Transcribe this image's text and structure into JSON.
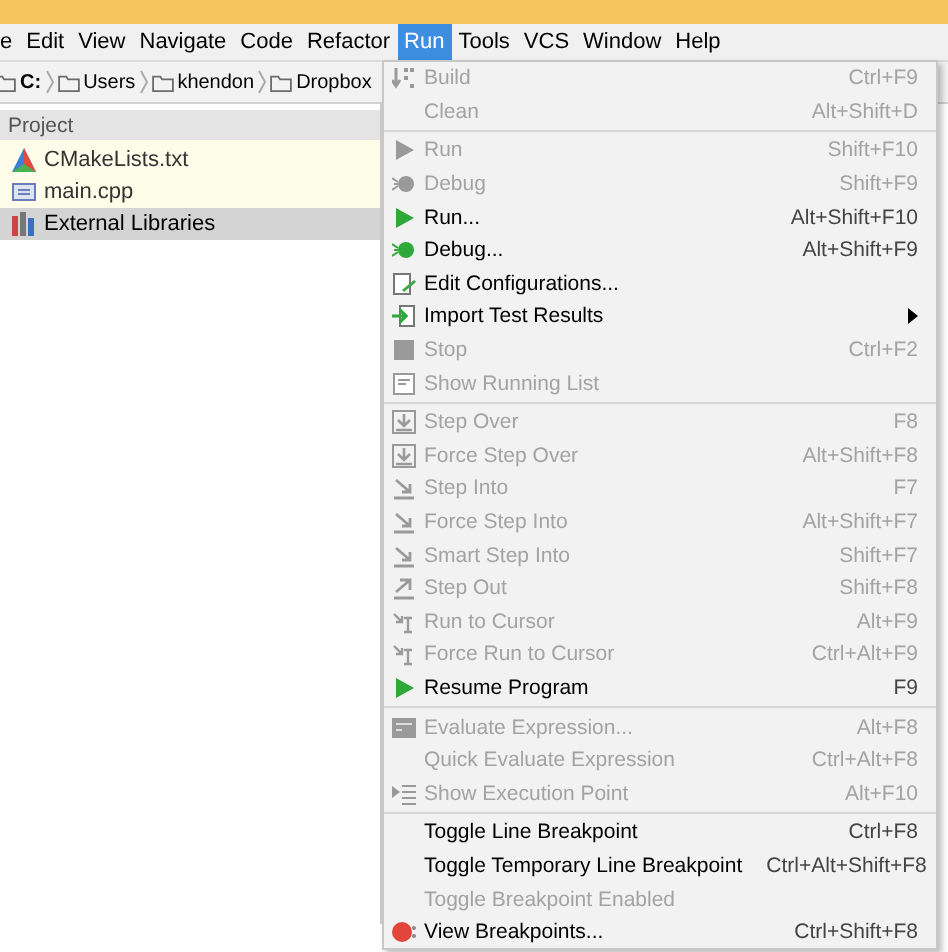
{
  "menubar": [
    {
      "label": "e",
      "selected": false
    },
    {
      "label": "Edit",
      "selected": false
    },
    {
      "label": "View",
      "selected": false
    },
    {
      "label": "Navigate",
      "selected": false
    },
    {
      "label": "Code",
      "selected": false
    },
    {
      "label": "Refactor",
      "selected": false
    },
    {
      "label": "Run",
      "selected": true
    },
    {
      "label": "Tools",
      "selected": false
    },
    {
      "label": "VCS",
      "selected": false
    },
    {
      "label": "Window",
      "selected": false
    },
    {
      "label": "Help",
      "selected": false
    }
  ],
  "breadcrumbs": [
    {
      "label": "C:",
      "kind": "drive"
    },
    {
      "label": "Users",
      "kind": "folder"
    },
    {
      "label": "khendon",
      "kind": "folder"
    },
    {
      "label": "Dropbox",
      "kind": "folder"
    }
  ],
  "project": {
    "title": "Project",
    "items": [
      {
        "label": "CMakeLists.txt",
        "kind": "cmake",
        "selected": false
      },
      {
        "label": "main.cpp",
        "kind": "cpp",
        "selected": false
      },
      {
        "label": "External Libraries",
        "kind": "library",
        "selected": true
      }
    ]
  },
  "run_menu": {
    "items": [
      {
        "kind": "item",
        "label": "Build",
        "shortcut": "Ctrl+F9",
        "disabled": true
      },
      {
        "kind": "item",
        "label": "Clean",
        "shortcut": "Alt+Shift+D",
        "disabled": true
      },
      {
        "kind": "separator"
      },
      {
        "kind": "item",
        "label": "Run",
        "shortcut": "Shift+F10",
        "disabled": true
      },
      {
        "kind": "item",
        "label": "Debug",
        "shortcut": "Shift+F9",
        "disabled": true
      },
      {
        "kind": "item",
        "label": "Run...",
        "shortcut": "Alt+Shift+F10",
        "disabled": false
      },
      {
        "kind": "item",
        "label": "Debug...",
        "shortcut": "Alt+Shift+F9",
        "disabled": false
      },
      {
        "kind": "item",
        "label": "Edit Configurations...",
        "disabled": false
      },
      {
        "kind": "item",
        "label": "Import Test Results",
        "disabled": false,
        "submenu": true
      },
      {
        "kind": "item",
        "label": "Stop",
        "shortcut": "Ctrl+F2",
        "disabled": true
      },
      {
        "kind": "item",
        "label": "Show Running List",
        "disabled": true
      },
      {
        "kind": "separator"
      },
      {
        "kind": "item",
        "label": "Step Over",
        "shortcut": "F8",
        "disabled": true
      },
      {
        "kind": "item",
        "label": "Force Step Over",
        "shortcut": "Alt+Shift+F8",
        "disabled": true
      },
      {
        "kind": "item",
        "label": "Step Into",
        "shortcut": "F7",
        "disabled": true
      },
      {
        "kind": "item",
        "label": "Force Step Into",
        "shortcut": "Alt+Shift+F7",
        "disabled": true
      },
      {
        "kind": "item",
        "label": "Smart Step Into",
        "shortcut": "Shift+F7",
        "disabled": true
      },
      {
        "kind": "item",
        "label": "Step Out",
        "shortcut": "Shift+F8",
        "disabled": true
      },
      {
        "kind": "item",
        "label": "Run to Cursor",
        "shortcut": "Alt+F9",
        "disabled": true
      },
      {
        "kind": "item",
        "label": "Force Run to Cursor",
        "shortcut": "Ctrl+Alt+F9",
        "disabled": true
      },
      {
        "kind": "item",
        "label": "Resume Program",
        "shortcut": "F9",
        "disabled": false
      },
      {
        "kind": "separator"
      },
      {
        "kind": "item",
        "label": "Evaluate Expression...",
        "shortcut": "Alt+F8",
        "disabled": true
      },
      {
        "kind": "item",
        "label": "Quick Evaluate Expression",
        "shortcut": "Ctrl+Alt+F8",
        "disabled": true
      },
      {
        "kind": "item",
        "label": "Show Execution Point",
        "shortcut": "Alt+F10",
        "disabled": true
      },
      {
        "kind": "separator"
      },
      {
        "kind": "item",
        "label": "Toggle Line Breakpoint",
        "shortcut": "Ctrl+F8",
        "disabled": false
      },
      {
        "kind": "item",
        "label": "Toggle Temporary Line Breakpoint",
        "shortcut": "Ctrl+Alt+Shift+F8",
        "disabled": false
      },
      {
        "kind": "item",
        "label": "Toggle Breakpoint Enabled",
        "disabled": true
      },
      {
        "kind": "item",
        "label": "View Breakpoints...",
        "shortcut": "Ctrl+Shift+F8",
        "disabled": false
      }
    ]
  }
}
